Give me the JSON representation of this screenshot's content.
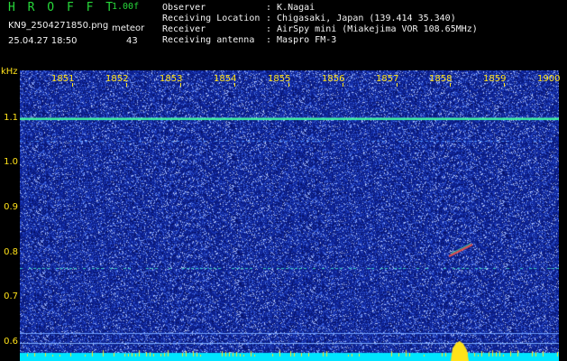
{
  "header": {
    "app_title": "H R O F F T",
    "version": "1.00f",
    "filename": "KN9_2504271850.png",
    "mode_label": "meteor",
    "timestamp": "25.04.27 18:50",
    "count": "43"
  },
  "station_info": [
    {
      "label": "Observer",
      "value": ": K.Nagai"
    },
    {
      "label": "Receiving Location",
      "value": ": Chigasaki, Japan (139.414 35.340)"
    },
    {
      "label": "Receiver",
      "value": ": AirSpy mini (Miakejima VOR 108.65MHz)"
    },
    {
      "label": "Receiving antenna",
      "value": ": Maspro FM-3"
    }
  ],
  "axes": {
    "y_unit": "kHz",
    "y_ticks": [
      "1.1",
      "1.0",
      "0.9",
      "0.8",
      "0.7",
      "0.6"
    ],
    "x_ticks": [
      "1851",
      "1852",
      "1853",
      "1854",
      "1855",
      "1856",
      "1857",
      "1858",
      "1859",
      "1900"
    ]
  },
  "colors": {
    "background": "#000000",
    "header_green": "#27d83a",
    "label_yellow": "#ffe21a",
    "spectrum_base": "#0c1f8c",
    "carrier_line": "#3cf0a0",
    "baseline_cyan": "#00e5ff"
  }
}
